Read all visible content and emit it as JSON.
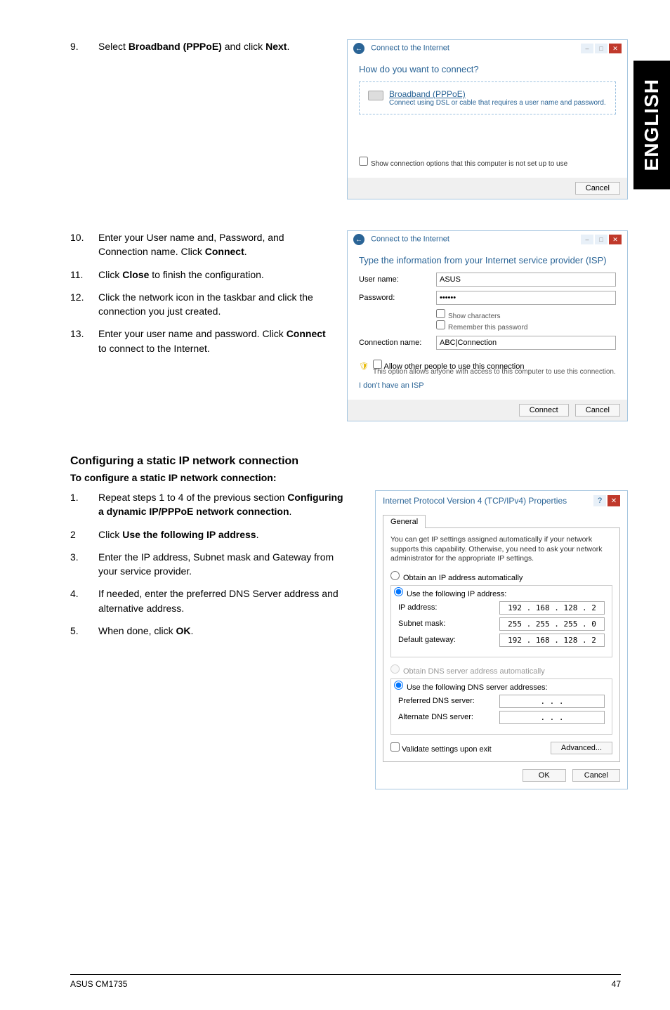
{
  "sideTab": "ENGLISH",
  "step9": {
    "num": "9.",
    "text_a": "Select ",
    "bold": "Broadband (PPPoE)",
    "text_b": " and click ",
    "bold2": "Next",
    "text_c": "."
  },
  "dialog1": {
    "title": "Connect to the Internet",
    "heading": "How do you want to connect?",
    "optionTitle": "Broadband (PPPoE)",
    "optionDesc": "Connect using DSL or cable that requires a user name and password.",
    "showOptions": "Show connection options that this computer is not set up to use",
    "cancel": "Cancel"
  },
  "step10": {
    "num": "10.",
    "text_a": "Enter your User name and, Password, and Connection name. Click ",
    "bold": "Connect",
    "text_b": "."
  },
  "step11": {
    "num": "11.",
    "text_a": "Click ",
    "bold": "Close",
    "text_b": " to finish the configuration."
  },
  "step12": {
    "num": "12.",
    "text": "Click the network icon in the taskbar and click the connection you just created."
  },
  "step13": {
    "num": "13.",
    "text_a": "Enter your user name and password. Click ",
    "bold": "Connect",
    "text_b": " to connect to the Internet."
  },
  "dialog2": {
    "title": "Connect to the Internet",
    "heading": "Type the information from your Internet service provider (ISP)",
    "userLabel": "User name:",
    "userValue": "ASUS",
    "passLabel": "Password:",
    "passValue": "••••••",
    "showChars": "Show characters",
    "remember": "Remember this password",
    "connNameLabel": "Connection name:",
    "connNameValue": "ABC|Connection",
    "allowOther": "Allow other people to use this connection",
    "allowDesc": "This option allows anyone with access to this computer to use this connection.",
    "noIsp": "I don't have an ISP",
    "connect": "Connect",
    "cancel": "Cancel"
  },
  "sectionTitle": "Configuring a static IP network connection",
  "sectionSub": "To configure a static IP network connection:",
  "stepS1": {
    "num": "1.",
    "text_a": "Repeat steps 1 to 4 of the previous section ",
    "bold": "Configuring a dynamic IP/PPPoE network connection",
    "text_b": "."
  },
  "stepS2": {
    "num": "2",
    "text_a": "Click ",
    "bold": "Use the following IP address",
    "text_b": "."
  },
  "stepS3": {
    "num": "3.",
    "text": "Enter the IP address, Subnet mask and Gateway from your service provider."
  },
  "stepS4": {
    "num": "4.",
    "text": "If needed, enter the preferred DNS Server address and alternative address."
  },
  "stepS5": {
    "num": "5.",
    "text_a": "When done, click ",
    "bold": "OK",
    "text_b": "."
  },
  "ipv4": {
    "title": "Internet Protocol Version 4 (TCP/IPv4) Properties",
    "tab": "General",
    "desc": "You can get IP settings assigned automatically if your network supports this capability. Otherwise, you need to ask your network administrator for the appropriate IP settings.",
    "r1": "Obtain an IP address automatically",
    "r2": "Use the following IP address:",
    "ipLabel": "IP address:",
    "ipVal": "192 . 168 . 128 .   2",
    "smLabel": "Subnet mask:",
    "smVal": "255 . 255 . 255 .   0",
    "gwLabel": "Default gateway:",
    "gwVal": "192 . 168 . 128 .   2",
    "r3": "Obtain DNS server address automatically",
    "r4": "Use the following DNS server addresses:",
    "pdnsLabel": "Preferred DNS server:",
    "pdnsVal": ".       .       .",
    "adnsLabel": "Alternate DNS server:",
    "adnsVal": ".       .       .",
    "validate": "Validate settings upon exit",
    "advanced": "Advanced...",
    "ok": "OK",
    "cancel": "Cancel"
  },
  "footer": {
    "left": "ASUS CM1735",
    "right": "47"
  }
}
